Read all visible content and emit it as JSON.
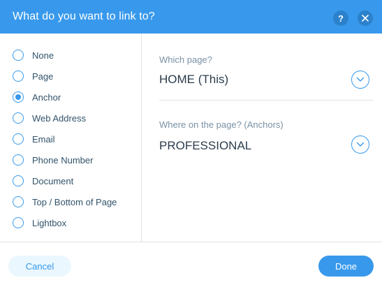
{
  "header": {
    "title": "What do you want to link to?",
    "help_glyph": "?",
    "help_icon": "question-mark-icon",
    "close_icon": "close-icon"
  },
  "link_types": [
    {
      "label": "None",
      "selected": false
    },
    {
      "label": "Page",
      "selected": false
    },
    {
      "label": "Anchor",
      "selected": true
    },
    {
      "label": "Web Address",
      "selected": false
    },
    {
      "label": "Email",
      "selected": false
    },
    {
      "label": "Phone Number",
      "selected": false
    },
    {
      "label": "Document",
      "selected": false
    },
    {
      "label": "Top / Bottom of Page",
      "selected": false
    },
    {
      "label": "Lightbox",
      "selected": false
    }
  ],
  "page_select": {
    "label": "Which page?",
    "value": "HOME (This)",
    "icon": "chevron-down-icon"
  },
  "anchor_select": {
    "label": "Where on the page? (Anchors)",
    "value": "PROFESSIONAL",
    "icon": "chevron-down-icon"
  },
  "footer": {
    "cancel_label": "Cancel",
    "done_label": "Done"
  },
  "colors": {
    "accent": "#3899ec",
    "header_button": "#2b81cb",
    "cancel_bg": "#eaf7ff",
    "text": "#32536a"
  }
}
